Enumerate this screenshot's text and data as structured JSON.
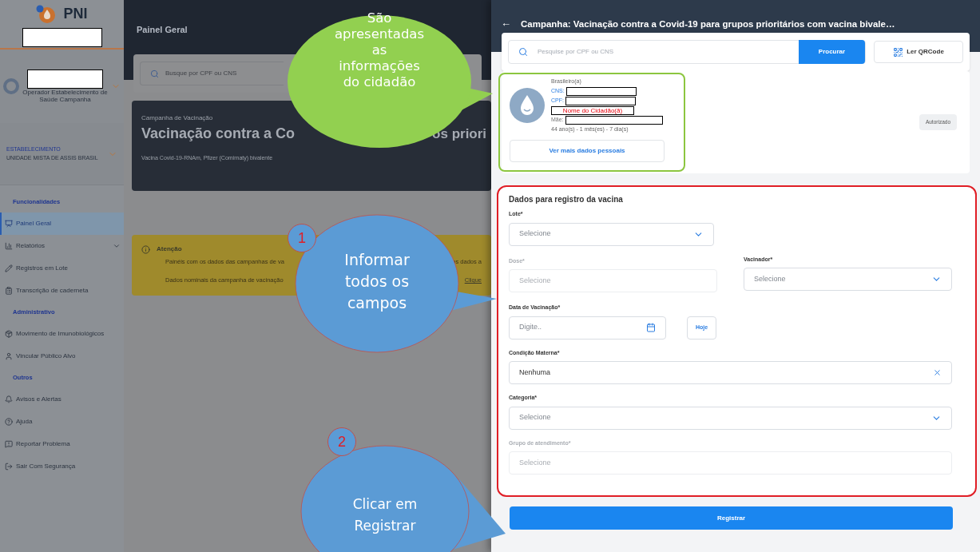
{
  "sidebar": {
    "logo_text": "PNI",
    "user_role": "Operador Estabelecimento de Saúde Campanha",
    "establishment_label": "ESTABELECIMENTO",
    "establishment": "UNIDADE MISTA DE ASSIS BRASIL",
    "sections": [
      {
        "title": "Funcionalidades",
        "items": [
          {
            "label": "Painel Geral",
            "selected": true,
            "submenu": false
          },
          {
            "label": "Relatórios",
            "selected": false,
            "submenu": true
          },
          {
            "label": "Registros em Lote",
            "selected": false,
            "submenu": false
          },
          {
            "label": "Transcrição de caderneta",
            "selected": false,
            "submenu": false
          }
        ]
      },
      {
        "title": "Administrativo",
        "items": [
          {
            "label": "Movimento de Imunobiológicos",
            "selected": false,
            "submenu": false
          },
          {
            "label": "Vincular Público Alvo",
            "selected": false,
            "submenu": false
          }
        ]
      },
      {
        "title": "Outros",
        "items": [
          {
            "label": "Avisos e Alertas",
            "selected": false,
            "submenu": false
          },
          {
            "label": "Ajuda",
            "selected": false,
            "submenu": false
          },
          {
            "label": "Reportar Problema",
            "selected": false,
            "submenu": false
          },
          {
            "label": "Sair Com Segurança",
            "selected": false,
            "submenu": false
          }
        ]
      }
    ]
  },
  "main": {
    "header_title": "Painel Geral",
    "search_placeholder": "Busque por CPF ou CNS",
    "campaign": {
      "label": "Campanha de Vacinação",
      "title_parts": [
        "Vacinação contra a Co",
        "os priori"
      ],
      "vaccine": "Vacina Covid-19-RNAm, Pfizer (Comirnaty) bivalente"
    },
    "alert": {
      "title": "Atenção",
      "lines": [
        [
          "Painéis com os dados das campanhas de va",
          "os dados a"
        ],
        [
          "Dados nominais da campanha de vacinação",
          "Clique"
        ]
      ]
    }
  },
  "panel": {
    "back": "←",
    "title": "Campanha: Vacinação contra a Covid-19 para grupos prioritários com vacina bivale…",
    "search_placeholder": "Pesquise por CPF ou CNS",
    "search_button": "Procurar",
    "qr_button": "Ler QRCode",
    "citizen": {
      "nationality": "Brasileiro(a)",
      "cns_label": "CNS:",
      "cpf_label": "CPF:",
      "name_placeholder": "Nome do Cidadão(ã)",
      "mother_label": "Mãe:",
      "age": "44 ano(s) - 1 mês(es) - 7 dia(s)",
      "more_button": "Ver mais dados pessoais",
      "status": "Autorizado"
    },
    "form": {
      "title": "Dados para registro da vacina",
      "fields": [
        {
          "label": "Lote*",
          "kind": "select",
          "placeholder": "Selecione",
          "disabled": false
        },
        {
          "label": "Dose*",
          "kind": "select",
          "placeholder": "Selecione",
          "disabled": true
        },
        {
          "label": "Vacinador*",
          "kind": "select",
          "placeholder": "Selecione",
          "disabled": false
        },
        {
          "label": "Data de Vacinação*",
          "kind": "date",
          "placeholder": "Digite..",
          "button": "Hoje",
          "disabled": false
        },
        {
          "label": "Condição Materna*",
          "kind": "clearable",
          "value": "Nenhuma",
          "disabled": false
        },
        {
          "label": "Categoria*",
          "kind": "select",
          "placeholder": "Selecione",
          "disabled": false
        },
        {
          "label": "Grupo de atendimento*",
          "kind": "select",
          "placeholder": "Selecione",
          "disabled": true
        }
      ]
    },
    "submit": "Registrar"
  },
  "callouts": [
    {
      "text": "São apresentadas as informações do cidadão",
      "color": "#92d050"
    },
    {
      "number": "1",
      "text": "Informar todos os campos",
      "color": "#5b9bd5"
    },
    {
      "number": "2",
      "text": "Clicar em Registrar",
      "color": "#5b9bd5"
    }
  ]
}
